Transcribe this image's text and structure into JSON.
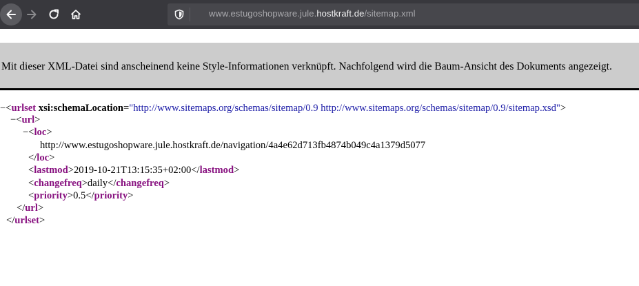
{
  "browser": {
    "url_prefix": "www.estugoshopware.jule.",
    "url_host": "hostkraft.de",
    "url_path": "/sitemap.xml"
  },
  "banner": {
    "text": "Mit dieser XML-Datei sind anscheinend keine Style-Informationen verknüpft. Nachfolgend wird die Baum-Ansicht des Dokuments angezeigt."
  },
  "xml": {
    "collapse_glyph": "−",
    "root_tag": "urlset",
    "attr_name": "xsi:schemaLocation",
    "attr_value": "\"http://www.sitemaps.org/schemas/sitemap/0.9 http://www.sitemaps.org/schemas/sitemap/0.9/sitemap.xsd\"",
    "url_tag": "url",
    "loc_tag": "loc",
    "loc_value": "http://www.estugoshopware.jule.hostkraft.de/navigation/4a4e62d713fb4874b049c4a1379d5077",
    "lastmod_tag": "lastmod",
    "lastmod_value": "2019-10-21T13:15:35+02:00",
    "changefreq_tag": "changefreq",
    "changefreq_value": "daily",
    "priority_tag": "priority",
    "priority_value": "0.5"
  }
}
